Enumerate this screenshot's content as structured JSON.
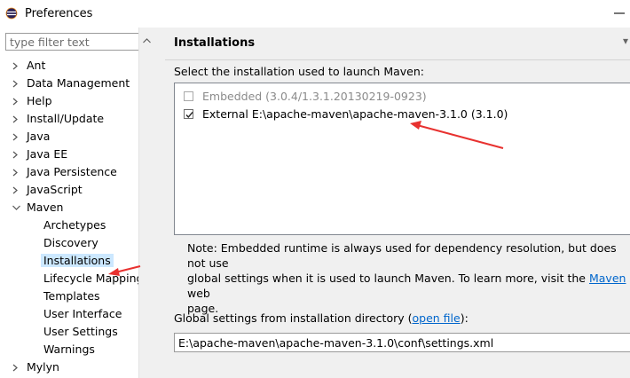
{
  "window": {
    "title": "Preferences"
  },
  "filter": {
    "placeholder": "type filter text"
  },
  "tree": {
    "items": [
      {
        "label": "Ant",
        "expanded": false
      },
      {
        "label": "Data Management",
        "expanded": false
      },
      {
        "label": "Help",
        "expanded": false
      },
      {
        "label": "Install/Update",
        "expanded": false
      },
      {
        "label": "Java",
        "expanded": false
      },
      {
        "label": "Java EE",
        "expanded": false
      },
      {
        "label": "Java Persistence",
        "expanded": false
      },
      {
        "label": "JavaScript",
        "expanded": false
      },
      {
        "label": "Maven",
        "expanded": true
      },
      {
        "label": "Mylyn",
        "expanded": false
      }
    ],
    "maven_children": [
      "Archetypes",
      "Discovery",
      "Installations",
      "Lifecycle Mapping",
      "Templates",
      "User Interface",
      "User Settings",
      "Warnings"
    ],
    "selected": "Installations"
  },
  "page": {
    "title": "Installations",
    "prompt": "Select the installation used to launch Maven:",
    "installations": [
      {
        "label": "Embedded (3.0.4/1.3.1.20130219-0923)",
        "checked": false,
        "enabled": false
      },
      {
        "label": "External E:\\apache-maven\\apache-maven-3.1.0 (3.1.0)",
        "checked": true,
        "enabled": true
      }
    ],
    "note_line1": "Note: Embedded runtime is always used for dependency resolution, but does not use",
    "note_line2_pre": "global settings when it is used to launch Maven. To learn more, visit the ",
    "note_link": "Maven",
    "note_line2_post": " web",
    "note_line3": "page.",
    "global_label": "Global settings from installation directory (",
    "global_link": "open file",
    "global_label_end": "):",
    "global_path": "E:\\apache-maven\\apache-maven-3.1.0\\conf\\settings.xml"
  },
  "colors": {
    "selection": "#cce8ff",
    "link": "#0066cc",
    "arrow": "#e8312f"
  }
}
